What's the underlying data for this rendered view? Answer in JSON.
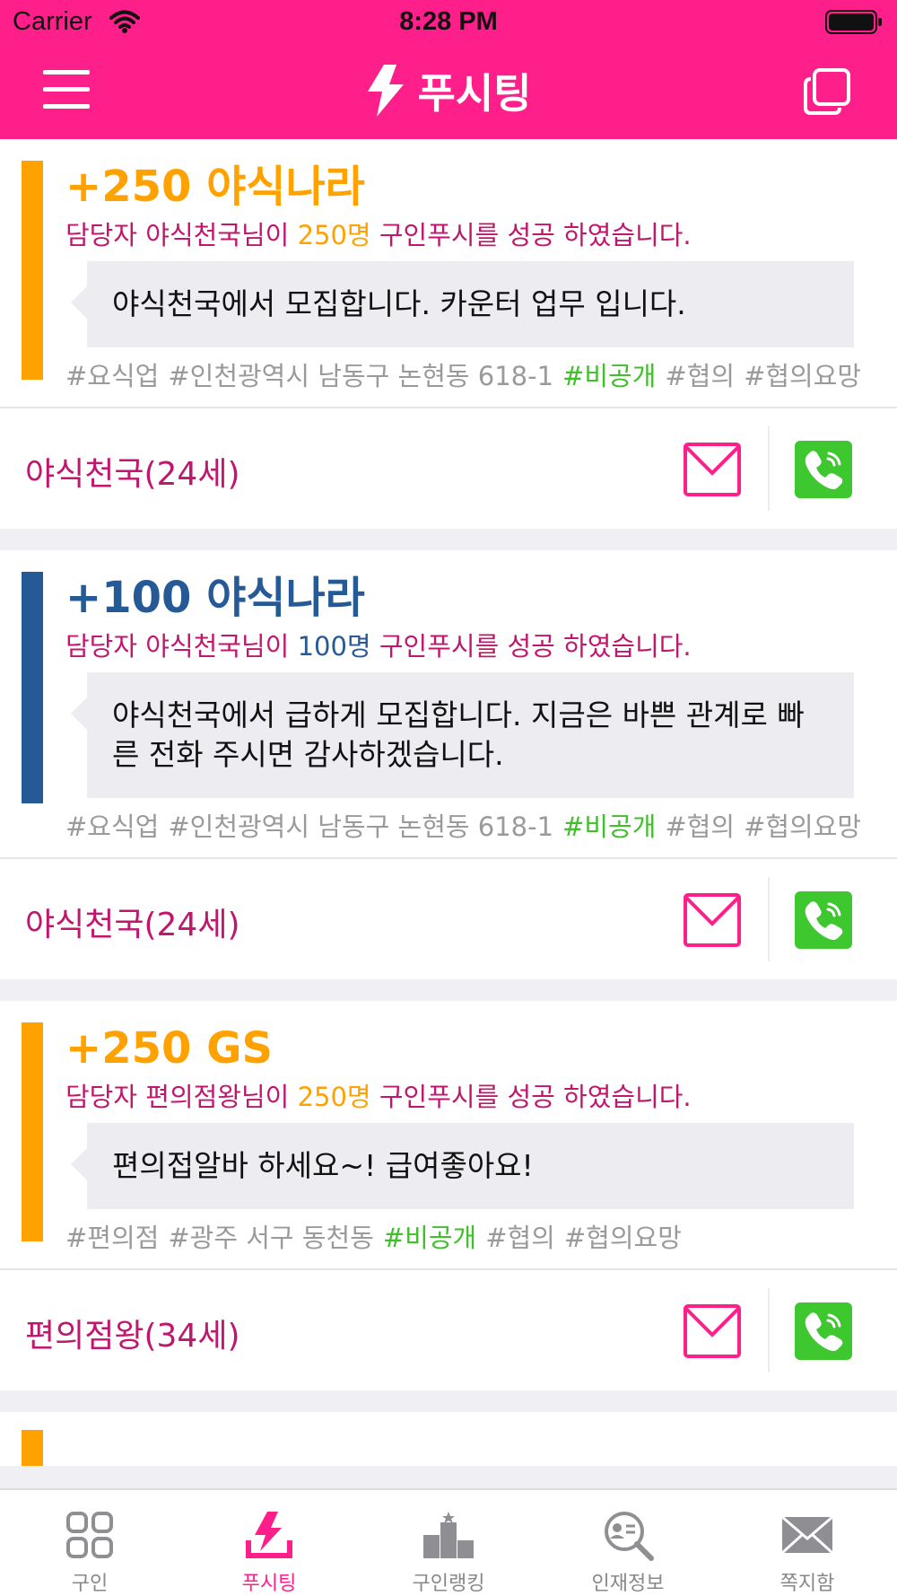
{
  "status_bar": {
    "carrier": "Carrier",
    "time": "8:28 PM"
  },
  "nav": {
    "title": "푸시팅",
    "bolt_icon": "bolt-icon",
    "menu_icon": "hamburger-menu-icon",
    "copy_icon": "copy-icon"
  },
  "colors": {
    "brand": "#ff1f8a",
    "orange": "#ffa200",
    "blue": "#255a96",
    "magenta_text": "#c0166e",
    "private_tag": "#3fbf2a",
    "call_green": "#3ec72e"
  },
  "cards": [
    {
      "accent": "#ffa200",
      "title": "+250 야식나라",
      "success_prefix": "담당자 야식천국님이 ",
      "success_count": "250명",
      "success_suffix": " 구인푸시를 성공 하였습니다.",
      "message": "야식천국에서 모집합니다. 카운터 업무 입니다.",
      "tags": [
        "#요식업",
        "#인천광역시 남동구 논현동 618-1",
        "#비공개",
        "#협의",
        "#협의요망"
      ],
      "person": "야식천국(24세)"
    },
    {
      "accent": "#255a96",
      "title": "+100 야식나라",
      "success_prefix": "담당자 야식천국님이 ",
      "success_count": "100명",
      "success_suffix": " 구인푸시를 성공 하였습니다.",
      "message": "야식천국에서 급하게 모집합니다. 지금은 바쁜 관계로 빠른 전화 주시면 감사하겠습니다.",
      "tags": [
        "#요식업",
        "#인천광역시 남동구 논현동 618-1",
        "#비공개",
        "#협의",
        "#협의요망"
      ],
      "person": "야식천국(24세)"
    },
    {
      "accent": "#ffa200",
      "title": "+250 GS",
      "success_prefix": "담당자 편의점왕님이 ",
      "success_count": "250명",
      "success_suffix": " 구인푸시를 성공 하였습니다.",
      "message": "편의접알바 하세요~! 급여좋아요!",
      "tags": [
        "#편의점",
        "#광주 서구 동천동",
        "#비공개",
        "#협의",
        "#협의요망"
      ],
      "person": "편의점왕(34세)"
    }
  ],
  "private_tag_label": "#비공개",
  "tabs": [
    {
      "label": "구인",
      "icon": "grid-icon",
      "active": false
    },
    {
      "label": "푸시팅",
      "icon": "push-bolt-icon",
      "active": true
    },
    {
      "label": "구인랭킹",
      "icon": "podium-icon",
      "active": false
    },
    {
      "label": "인재정보",
      "icon": "person-search-icon",
      "active": false
    },
    {
      "label": "쪽지함",
      "icon": "envelope-icon",
      "active": false
    }
  ]
}
